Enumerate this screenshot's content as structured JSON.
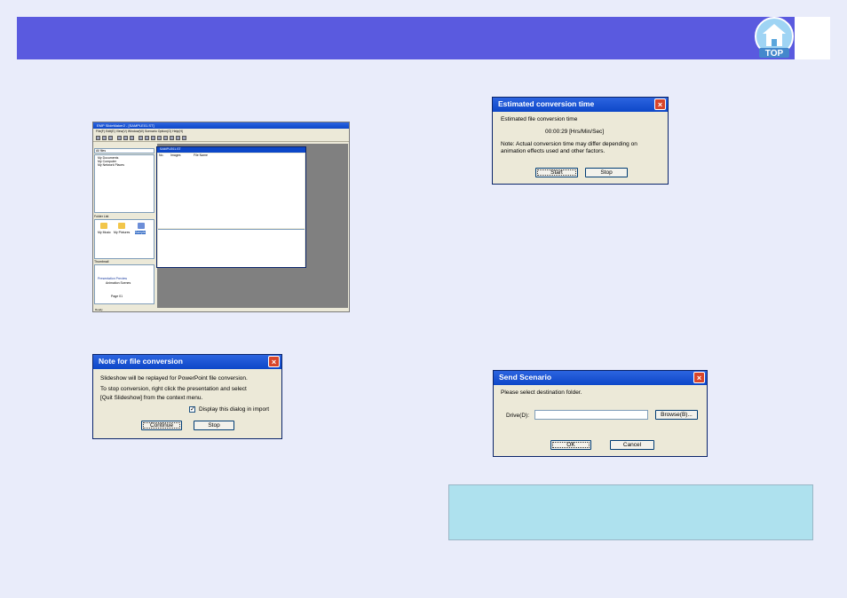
{
  "header": {
    "logo_text": "TOP"
  },
  "app_screenshot": {
    "title": "EMP SlideMaker2 - [SAMPLE01.ST]",
    "menu": "File(F)  Edit(E)  View(V)  Window(W)  Scenario Option(O)  Help(H)",
    "folder_combo": "All files",
    "tree_items": [
      "My Documents",
      "My Computer",
      "My Network Places"
    ],
    "folder_list_label": "Folder List",
    "folders": [
      "My Music",
      "My Pictures",
      "Sample"
    ],
    "thumbnail_label": "Thumbnail",
    "thumbnail_title": "Presentation Preview",
    "thumbnail_sub": "Animation Scenes",
    "thumbnail_page": "Page 01",
    "child_title": "SAMPLE01.ST",
    "columns": [
      "No.",
      "Images",
      "File Name"
    ],
    "status": "Ready"
  },
  "note_dialog": {
    "title": "Note for file conversion",
    "line1": "Slideshow will be replayed for PowerPoint file conversion.",
    "line2": "To stop conversion, right click the presentation and select",
    "line3": "[Quit Slideshow] from the context menu.",
    "checkbox_label": "Display this dialog in import",
    "checkbox_checked": true,
    "continue_label": "Continue",
    "stop_label": "Stop"
  },
  "time_dialog": {
    "title": "Estimated conversion time",
    "label": "Estimated file conversion time",
    "time": "00:00:29 [Hrs/Min/Sec]",
    "note1": "Note: Actual conversion time may differ depending on",
    "note2": "animation effects used and other factors.",
    "start_label": "Start",
    "stop_label": "Stop"
  },
  "send_dialog": {
    "title": "Send Scenario",
    "prompt": "Please select destination folder.",
    "drive_label": "Drive(D):",
    "drive_value": "",
    "browse_label": "Browse(B)...",
    "ok_label": "OK",
    "cancel_label": "Cancel"
  },
  "colors": {
    "header": "#5a5adf",
    "background": "#e9ecfa",
    "note_box": "#aee1ee",
    "titlebar": "#0d47c8"
  }
}
